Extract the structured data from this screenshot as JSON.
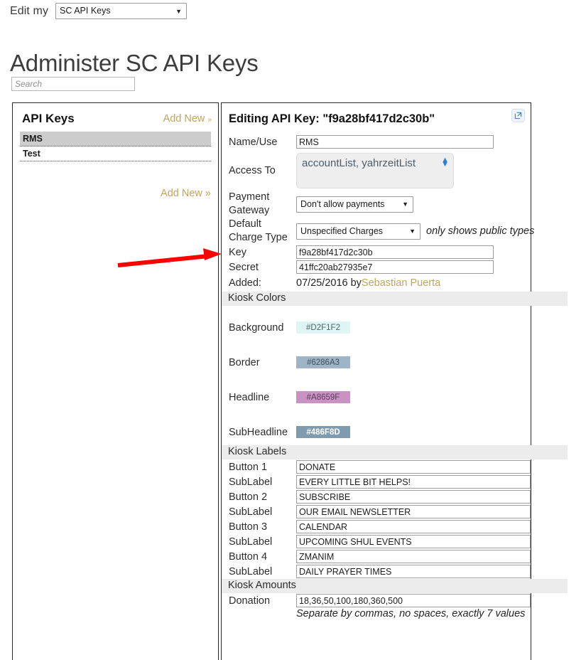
{
  "topbar": {
    "label": "Edit my",
    "selected": "SC API Keys",
    "options": [
      "SC API Keys"
    ],
    "arrow_icon": "chevron-down-icon"
  },
  "page_title": "Administer SC API Keys",
  "search": {
    "placeholder": "Search",
    "value": ""
  },
  "left_panel": {
    "title": "API Keys",
    "add_new_top": "Add New",
    "add_new_bottom": "Add New",
    "add_new_chevron": "»",
    "items": [
      {
        "label": "RMS",
        "selected": true
      },
      {
        "label": "Test",
        "selected": false
      }
    ]
  },
  "right_panel": {
    "title": "Editing API Key: \"f9a28bf417d2c30b\"",
    "external_link_icon": "external-link-icon",
    "fields": {
      "name_use_label": "Name/Use",
      "name_use_value": "RMS",
      "access_to_label": "Access To",
      "access_to_value": "accountList, yahrzeitList",
      "access_to_options": [
        "accountList",
        "yahrzeitList"
      ],
      "payment_gateway_label": "Payment Gateway",
      "payment_gateway_value": "Don't allow payments",
      "payment_gateway_options": [
        "Don't allow payments"
      ],
      "default_charge_type_label": "Default Charge Type",
      "default_charge_type_value": "Unspecified Charges",
      "default_charge_type_options": [
        "Unspecified Charges"
      ],
      "default_charge_type_note": "only shows public types",
      "key_label": "Key",
      "key_value": "f9a28bf417d2c30b",
      "secret_label": "Secret",
      "secret_value": "41ffc20ab27935e7",
      "added_label": "Added:",
      "added_date": "07/25/2016 by ",
      "added_user": "Sebastian Puerta"
    },
    "kiosk_colors": {
      "section_title": "Kiosk Colors",
      "rows": [
        {
          "label": "Background",
          "value": "#D2F1F2",
          "swatch_bg": "#dff5f5",
          "text_color": "#4f6465"
        },
        {
          "label": "Border",
          "value": "#6286A3",
          "swatch_bg": "#9fb5c7",
          "text_color": "#3f4f5c"
        },
        {
          "label": "Headline",
          "value": "#A8659F",
          "swatch_bg": "#c992c2",
          "text_color": "#5a3e57"
        },
        {
          "label": "SubHeadline",
          "value": "#486F8D",
          "swatch_bg": "#7e9bb0",
          "text_color": "#ffffff"
        }
      ],
      "picker": {
        "name": "color-wheel-picker",
        "wheel_type": "pastel-hue-ring",
        "square_type": "saturation-value-square"
      }
    },
    "kiosk_labels": {
      "section_title": "Kiosk Labels",
      "rows": [
        {
          "label": "Button 1",
          "value": "DONATE"
        },
        {
          "label": "SubLabel",
          "value": "EVERY LITTLE BIT HELPS!"
        },
        {
          "label": "Button 2",
          "value": "SUBSCRIBE"
        },
        {
          "label": "SubLabel",
          "value": "OUR EMAIL NEWSLETTER"
        },
        {
          "label": "Button 3",
          "value": "CALENDAR"
        },
        {
          "label": "SubLabel",
          "value": "UPCOMING SHUL EVENTS"
        },
        {
          "label": "Button 4",
          "value": "ZMANIM"
        },
        {
          "label": "SubLabel",
          "value": "DAILY PRAYER TIMES"
        }
      ]
    },
    "kiosk_amounts": {
      "section_title": "Kiosk Amounts",
      "donation_label": "Donation",
      "donation_value": "18,36,50,100,180,360,500",
      "hint": "Separate by commas, no spaces, exactly 7 values"
    }
  },
  "annotation": {
    "arrow_color": "#ff0000",
    "points_at": "key-field"
  }
}
